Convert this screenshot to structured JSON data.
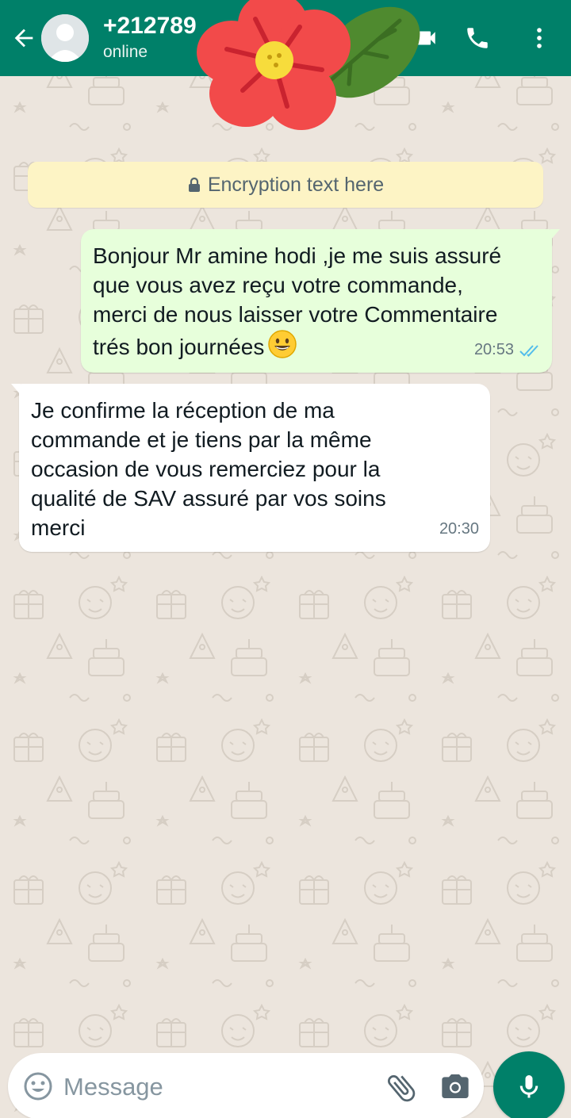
{
  "header": {
    "contact_name": "+212789",
    "status": "online"
  },
  "encryption": {
    "text": "Encryption text here"
  },
  "messages": [
    {
      "direction": "outgoing",
      "text": "Bonjour  Mr amine hodi ,je me suis assuré\nque vous avez reçu votre commande,\nmerci de nous laisser votre Commentaire\ntrés bon journées",
      "emoji": "grinning-face",
      "time": "20:53",
      "status": "read"
    },
    {
      "direction": "incoming",
      "text": "Je confirme la réception  de ma\ncommande et je tiens par la même\noccasion  de vous remerciez pour  la\nqualité  de SAV assuré  par vos soins\nmerci",
      "time": "20:30"
    }
  ],
  "composer": {
    "placeholder": "Message",
    "value": ""
  },
  "icons": {
    "back": "back-arrow-icon",
    "video": "video-call-icon",
    "call": "phone-icon",
    "menu": "more-vert-icon",
    "emoji": "emoji-icon",
    "attach": "paperclip-icon",
    "camera": "camera-icon",
    "mic": "mic-icon",
    "lock": "lock-icon"
  },
  "colors": {
    "header": "#008069",
    "outgoing_bubble": "#e7ffdb",
    "incoming_bubble": "#ffffff",
    "encryption_banner": "#fdf4c5",
    "read_ticks": "#53bdeb"
  }
}
